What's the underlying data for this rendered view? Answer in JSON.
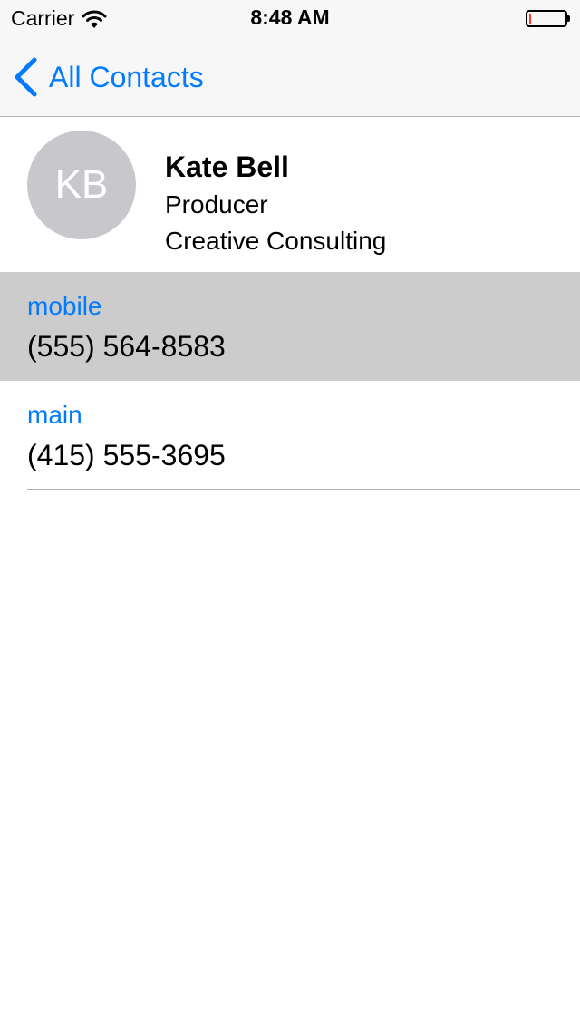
{
  "status_bar": {
    "carrier": "Carrier",
    "time": "8:48 AM"
  },
  "nav": {
    "back_label": "All Contacts"
  },
  "contact": {
    "initials": "KB",
    "name": "Kate Bell",
    "title": "Producer",
    "company": "Creative Consulting"
  },
  "phones": [
    {
      "label": "mobile",
      "number": "(555) 564-8583"
    },
    {
      "label": "main",
      "number": "(415) 555-3695"
    }
  ],
  "colors": {
    "accent": "#007aff",
    "avatar": "#c7c7cc",
    "selected_row": "#cccccc"
  },
  "icons": {
    "wifi": "wifi-icon",
    "battery": "battery-icon",
    "back": "chevron-left-icon"
  }
}
